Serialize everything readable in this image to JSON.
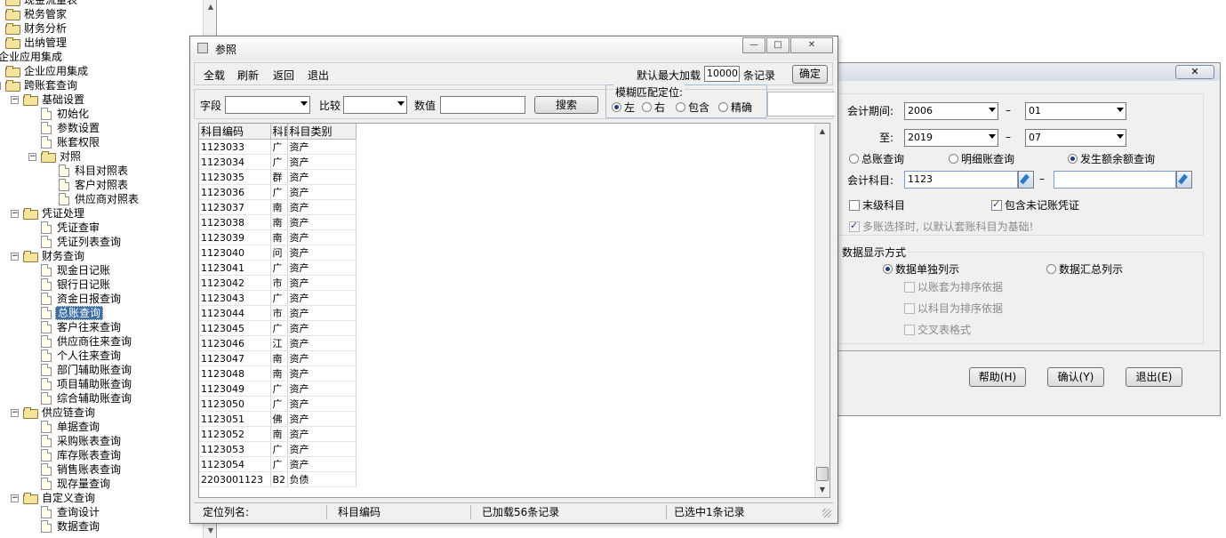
{
  "tree": {
    "items": [
      {
        "label": "现金流量表",
        "type": "folder"
      },
      {
        "label": "税务管家",
        "type": "folder"
      },
      {
        "label": "财务分析",
        "type": "folder"
      },
      {
        "label": "出纳管理",
        "type": "folder"
      },
      {
        "label": "企业应用集成",
        "type": "root"
      },
      {
        "label": "企业应用集成",
        "type": "folder"
      },
      {
        "label": "跨账套查询",
        "type": "folder"
      },
      {
        "label": "基础设置",
        "type": "folder"
      },
      {
        "label": "初始化",
        "type": "doc"
      },
      {
        "label": "参数设置",
        "type": "doc"
      },
      {
        "label": "账套权限",
        "type": "doc"
      },
      {
        "label": "对照",
        "type": "folder"
      },
      {
        "label": "科目对照表",
        "type": "doc"
      },
      {
        "label": "客户对照表",
        "type": "doc"
      },
      {
        "label": "供应商对照表",
        "type": "doc"
      },
      {
        "label": "凭证处理",
        "type": "folder"
      },
      {
        "label": "凭证查审",
        "type": "doc"
      },
      {
        "label": "凭证列表查询",
        "type": "doc"
      },
      {
        "label": "财务查询",
        "type": "folder"
      },
      {
        "label": "现金日记账",
        "type": "doc"
      },
      {
        "label": "银行日记账",
        "type": "doc"
      },
      {
        "label": "资金日报查询",
        "type": "doc"
      },
      {
        "label": "总账查询",
        "type": "doc",
        "selected": true
      },
      {
        "label": "客户往来查询",
        "type": "doc"
      },
      {
        "label": "供应商往来查询",
        "type": "doc"
      },
      {
        "label": "个人往来查询",
        "type": "doc"
      },
      {
        "label": "部门辅助账查询",
        "type": "doc"
      },
      {
        "label": "项目辅助账查询",
        "type": "doc"
      },
      {
        "label": "综合辅助账查询",
        "type": "doc"
      },
      {
        "label": "供应链查询",
        "type": "folder"
      },
      {
        "label": "单据查询",
        "type": "doc"
      },
      {
        "label": "采购账表查询",
        "type": "doc"
      },
      {
        "label": "库存账表查询",
        "type": "doc"
      },
      {
        "label": "销售账表查询",
        "type": "doc"
      },
      {
        "label": "现存量查询",
        "type": "doc"
      },
      {
        "label": "自定义查询",
        "type": "folder"
      },
      {
        "label": "查询设计",
        "type": "doc"
      },
      {
        "label": "数据查询",
        "type": "doc"
      }
    ]
  },
  "query_dialog": {
    "close_label": "✕",
    "period_label": "会计期间:",
    "from_year": "2006",
    "from_month": "01",
    "dash": "–",
    "to_label": "至:",
    "to_year": "2019",
    "to_month": "07",
    "query_types": [
      {
        "label": "总账查询",
        "selected": false
      },
      {
        "label": "明细账查询",
        "selected": false
      },
      {
        "label": "发生额余额查询",
        "selected": true
      }
    ],
    "account_label": "会计科目:",
    "account_from": "1123",
    "account_to": "",
    "leaf_only_label": "末级科目",
    "leaf_only_checked": false,
    "include_unposted_label": "包含未记账凭证",
    "include_unposted_checked": true,
    "multi_note": "多账选择时, 以默认套账科目为基础!",
    "display_mode_title": "数据显示方式",
    "display_modes": [
      {
        "label": "数据单独列示",
        "selected": true
      },
      {
        "label": "数据汇总列示",
        "selected": false
      }
    ],
    "sub_options": [
      {
        "label": "以账套为排序依据"
      },
      {
        "label": "以科目为排序依据"
      },
      {
        "label": "交叉表格式"
      }
    ],
    "help_label": "帮助(H)",
    "ok_label": "确认(Y)",
    "exit_label": "退出(E)"
  },
  "ref_dialog": {
    "title": "参照",
    "minimize": "—",
    "maximize": "□",
    "close": "✕",
    "menu": [
      "全载",
      "刷新",
      "返回",
      "退出"
    ],
    "max_load_label": "默认最大加载",
    "max_load_value": "10000",
    "records_label": "条记录",
    "confirm_label": "确定",
    "field_label": "字段",
    "compare_label": "比较",
    "value_label": "数值",
    "search_label": "搜索",
    "fuzzy_title": "模糊匹配定位:",
    "fuzzy_options": [
      {
        "label": "左",
        "selected": true
      },
      {
        "label": "右",
        "selected": false
      },
      {
        "label": "包含",
        "selected": false
      },
      {
        "label": "精确",
        "selected": false
      }
    ],
    "columns": [
      "科目编码",
      "科目",
      "科目类别"
    ],
    "rows": [
      [
        "1123033",
        "广",
        "资产"
      ],
      [
        "1123034",
        "广",
        "资产"
      ],
      [
        "1123035",
        "群",
        "资产"
      ],
      [
        "1123036",
        "广",
        "资产"
      ],
      [
        "1123037",
        "南",
        "资产"
      ],
      [
        "1123038",
        "南",
        "资产"
      ],
      [
        "1123039",
        "南",
        "资产"
      ],
      [
        "1123040",
        "问",
        "资产"
      ],
      [
        "1123041",
        "广",
        "资产"
      ],
      [
        "1123042",
        "市",
        "资产"
      ],
      [
        "1123043",
        "广",
        "资产"
      ],
      [
        "1123044",
        "市",
        "资产"
      ],
      [
        "1123045",
        "广",
        "资产"
      ],
      [
        "1123046",
        "江",
        "资产"
      ],
      [
        "1123047",
        "南",
        "资产"
      ],
      [
        "1123048",
        "南",
        "资产"
      ],
      [
        "1123049",
        "广",
        "资产"
      ],
      [
        "1123050",
        "广",
        "资产"
      ],
      [
        "1123051",
        "佛",
        "资产"
      ],
      [
        "1123052",
        "南",
        "资产"
      ],
      [
        "1123053",
        "广",
        "资产"
      ],
      [
        "1123054",
        "广",
        "资产"
      ],
      [
        "2203001123",
        "B2",
        "负债"
      ]
    ],
    "status": {
      "locate_col_label": "定位列名:",
      "locate_col_value": "科目编码",
      "loaded": "已加载56条记录",
      "selected": "已选中1条记录"
    }
  }
}
